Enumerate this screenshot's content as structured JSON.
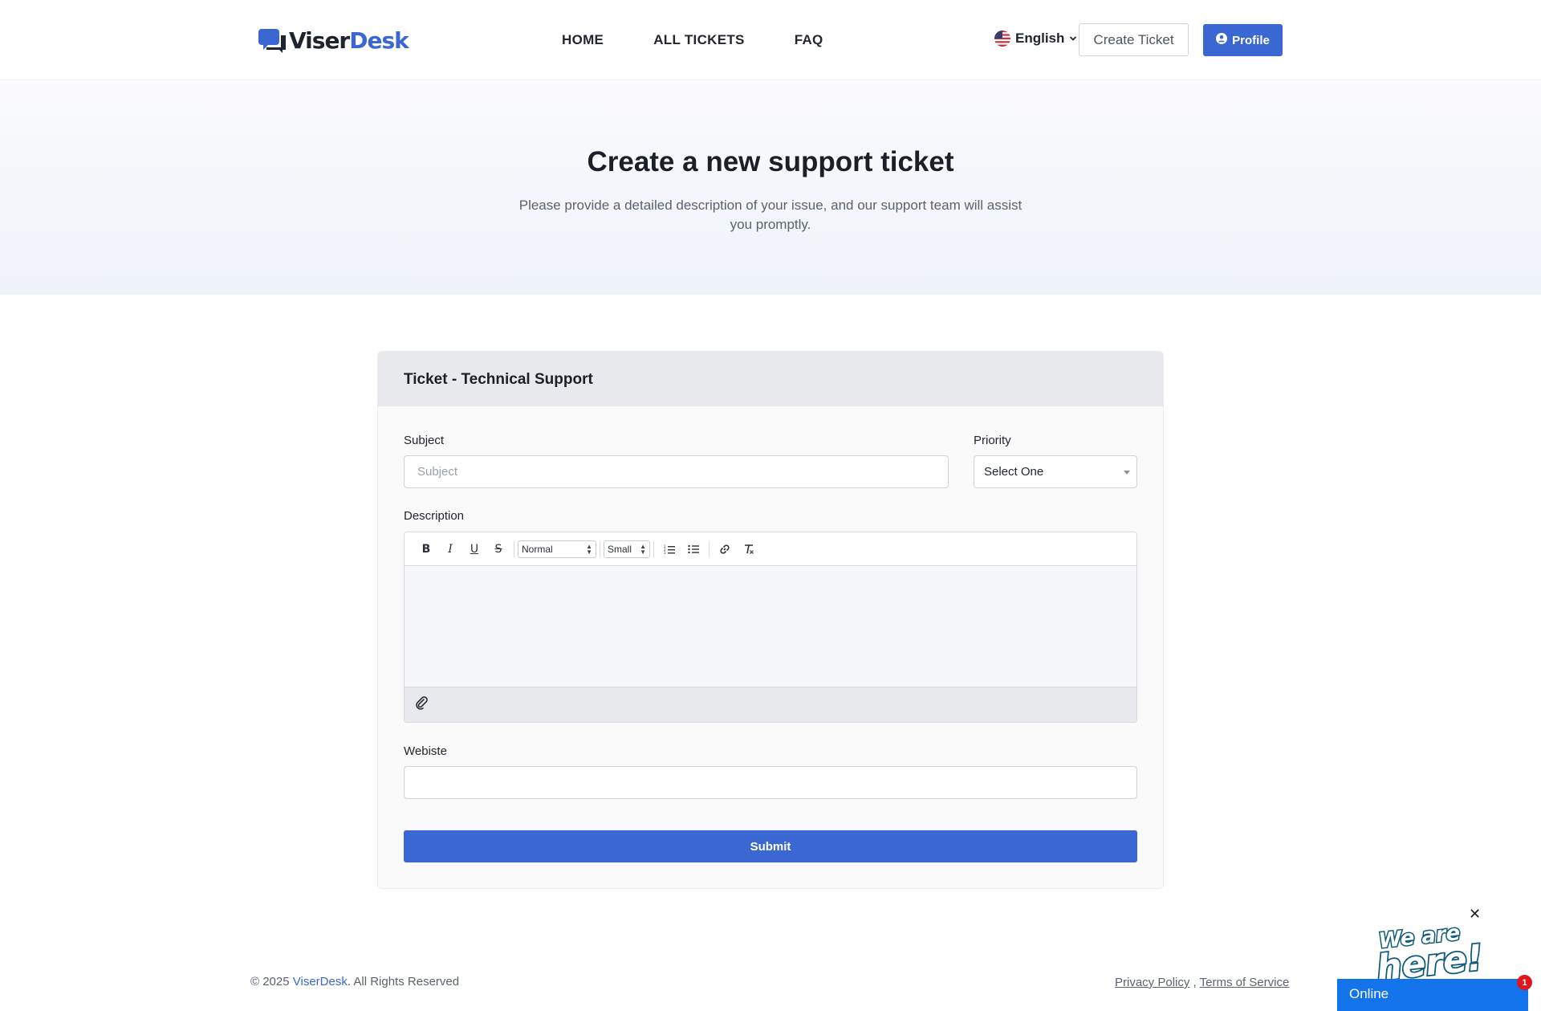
{
  "brand": {
    "name_part1": "Viser",
    "name_part2": "Desk",
    "accent_color": "#3a67d1"
  },
  "nav": {
    "items": [
      {
        "label": "HOME"
      },
      {
        "label": "ALL TICKETS"
      },
      {
        "label": "FAQ"
      }
    ]
  },
  "header": {
    "language": "English",
    "language_flag_icon": "us-flag-icon",
    "create_ticket_label": "Create Ticket",
    "profile_label": "Profile",
    "profile_icon": "user-circle-icon"
  },
  "hero": {
    "title": "Create a new support ticket",
    "subtitle": "Please provide a detailed description of your issue, and our support team will assist you promptly."
  },
  "form": {
    "card_title": "Ticket - Technical Support",
    "subject_label": "Subject",
    "subject_placeholder": "Subject",
    "priority_label": "Priority",
    "priority_selected": "Select One",
    "description_label": "Description",
    "toolbar": {
      "bold": "B",
      "italic": "I",
      "underline": "U",
      "strike": "S",
      "header_select": "Normal",
      "size_select": "Small",
      "ordered_list_icon": "ordered-list-icon",
      "bullet_list_icon": "bullet-list-icon",
      "link_icon": "link-icon",
      "clear_format_icon": "clear-format-icon"
    },
    "attachment_icon": "paperclip-icon",
    "website_label": "Webiste",
    "website_value": "",
    "submit_label": "Submit"
  },
  "footer": {
    "copyright_prefix": "© 2025 ",
    "copyright_brand": "ViserDesk",
    "copyright_suffix": ". All Rights Reserved",
    "privacy_label": "Privacy Policy",
    "separator": ",",
    "terms_label": "Terms of Service"
  },
  "chat": {
    "badge_text": "We are here!",
    "status": "Online",
    "unread_count": "1",
    "bar_color": "#1273eb"
  }
}
